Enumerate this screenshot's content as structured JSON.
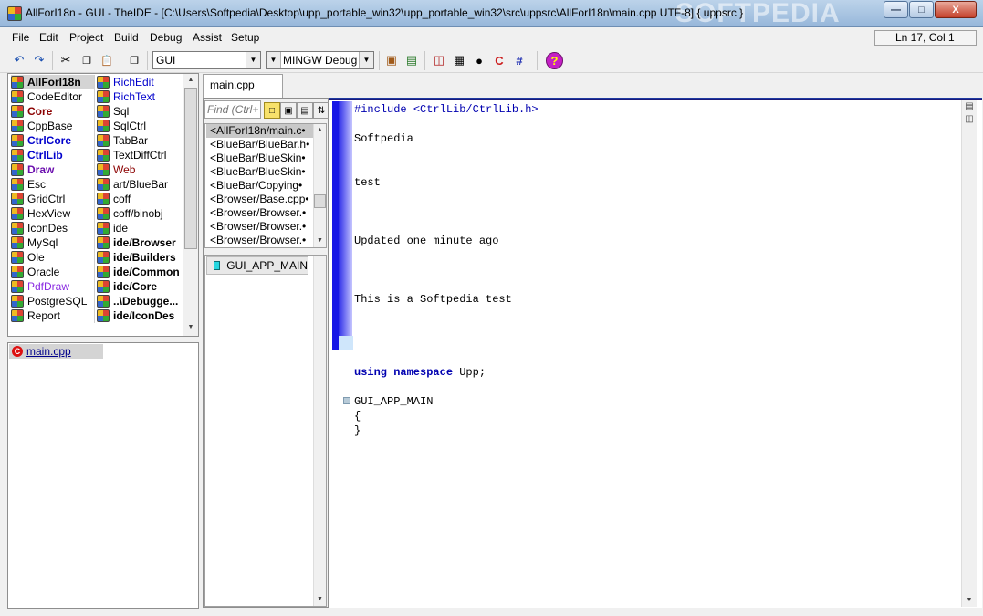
{
  "window": {
    "title": "AllForI18n - GUI - TheIDE - [C:\\Users\\Softpedia\\Desktop\\upp_portable_win32\\upp_portable_win32\\src\\uppsrc\\AllForI18n\\main.cpp UTF-8] { uppsrc }",
    "watermark": "SOFTPEDIA",
    "min_label": "—",
    "max_label": "□",
    "close_label": "X"
  },
  "menu": [
    "File",
    "Edit",
    "Project",
    "Build",
    "Debug",
    "Assist",
    "Setup"
  ],
  "status": {
    "cursor": "Ln 17, Col 1"
  },
  "toolbar": {
    "main_config": "GUI",
    "build_method": "MINGW Debug"
  },
  "packages": {
    "col1": [
      {
        "label": "AllForI18n",
        "style": "bold",
        "color": "#000000"
      },
      {
        "label": "CodeEditor",
        "style": "normal",
        "color": "#000000"
      },
      {
        "label": "Core",
        "style": "bold",
        "color": "#8b0000"
      },
      {
        "label": "CppBase",
        "style": "normal",
        "color": "#000000"
      },
      {
        "label": "CtrlCore",
        "style": "bold",
        "color": "#0000cc"
      },
      {
        "label": "CtrlLib",
        "style": "bold",
        "color": "#0000cc"
      },
      {
        "label": "Draw",
        "style": "bold",
        "color": "#6a0dad"
      },
      {
        "label": "Esc",
        "style": "normal",
        "color": "#000000"
      },
      {
        "label": "GridCtrl",
        "style": "normal",
        "color": "#000000"
      },
      {
        "label": "HexView",
        "style": "normal",
        "color": "#000000"
      },
      {
        "label": "IconDes",
        "style": "normal",
        "color": "#000000"
      },
      {
        "label": "MySql",
        "style": "normal",
        "color": "#000000"
      },
      {
        "label": "Ole",
        "style": "normal",
        "color": "#000000"
      },
      {
        "label": "Oracle",
        "style": "normal",
        "color": "#000000"
      },
      {
        "label": "PdfDraw",
        "style": "normal",
        "color": "#8a2be2"
      },
      {
        "label": "PostgreSQL",
        "style": "normal",
        "color": "#000000"
      },
      {
        "label": "Report",
        "style": "normal",
        "color": "#000000"
      }
    ],
    "col2": [
      {
        "label": "RichEdit",
        "style": "normal",
        "color": "#0000cc"
      },
      {
        "label": "RichText",
        "style": "normal",
        "color": "#0000cc"
      },
      {
        "label": "Sql",
        "style": "normal",
        "color": "#000000"
      },
      {
        "label": "SqlCtrl",
        "style": "normal",
        "color": "#000000"
      },
      {
        "label": "TabBar",
        "style": "normal",
        "color": "#000000"
      },
      {
        "label": "TextDiffCtrl",
        "style": "normal",
        "color": "#000000"
      },
      {
        "label": "Web",
        "style": "normal",
        "color": "#8b0000"
      },
      {
        "label": "art/BlueBar",
        "style": "normal",
        "color": "#000000"
      },
      {
        "label": "coff",
        "style": "normal",
        "color": "#000000"
      },
      {
        "label": "coff/binobj",
        "style": "normal",
        "color": "#000000"
      },
      {
        "label": "ide",
        "style": "normal",
        "color": "#000000"
      },
      {
        "label": "ide/Browser",
        "style": "bold",
        "color": "#000000"
      },
      {
        "label": "ide/Builders",
        "style": "bold",
        "color": "#000000"
      },
      {
        "label": "ide/Common",
        "style": "bold",
        "color": "#000000"
      },
      {
        "label": "ide/Core",
        "style": "bold",
        "color": "#000000"
      },
      {
        "label": "..\\Debugge...",
        "style": "bold",
        "color": "#000000"
      },
      {
        "label": "ide/IconDes",
        "style": "bold",
        "color": "#000000"
      }
    ]
  },
  "files": [
    {
      "label": "main.cpp"
    }
  ],
  "tabs": [
    {
      "label": "main.cpp"
    }
  ],
  "browser": {
    "find_placeholder": "Find (Ctrl+",
    "items": [
      "<AllForI18n/main.c•",
      "<BlueBar/BlueBar.h•",
      "<BlueBar/BlueSkin•",
      "<BlueBar/BlueSkin•",
      "<BlueBar/Copying•",
      "<Browser/Base.cpp•",
      "<Browser/Browser.•",
      "<Browser/Browser.•",
      "<Browser/Browser.•"
    ],
    "symbol": "GUI_APP_MAIN"
  },
  "code": {
    "include_kw": "#include",
    "include_path": "<CtrlLib/CtrlLib.h>",
    "line_softpedia": "Softpedia",
    "line_test": "test",
    "line_updated": "Updated one minute ago",
    "line_sptest": "This is a Softpedia test",
    "using_kw": "using namespace",
    "using_ns": "Upp;",
    "main_macro": "GUI_APP_MAIN",
    "open_brace": "{",
    "close_brace": "}"
  }
}
